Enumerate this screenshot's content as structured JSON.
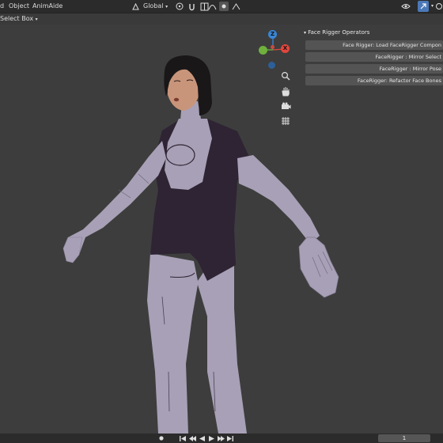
{
  "topbar": {
    "menu_items": [
      "d",
      "Object",
      "AnimAide"
    ],
    "transform_orientation": "Global"
  },
  "toolbar2": {
    "select_mode": "Select Box"
  },
  "gizmo": {
    "z_label": "Z",
    "x_label": "X",
    "colors": {
      "x": "#e2463c",
      "y": "#6fb13c",
      "z": "#3a86d4"
    }
  },
  "nav_icons": [
    "zoom-icon",
    "hand-pan-icon",
    "camera-icon",
    "grid-ortho-icon"
  ],
  "panel": {
    "title": "Face Rigger Operators",
    "buttons": [
      "Face Rigger: Load FaceRigger Compon",
      "FaceRigger : Mirror Select",
      "FaceRigger : Mirror Pose",
      "FaceRigger: Refactor Face Bones"
    ]
  },
  "timeline": {
    "current_frame": "1"
  },
  "colors": {
    "viewport_bg": "#3d3d3d",
    "suit_light": "#a8a0b6",
    "suit_dark": "#2e2433",
    "skin": "#c9957a",
    "hair": "#1a1718"
  }
}
